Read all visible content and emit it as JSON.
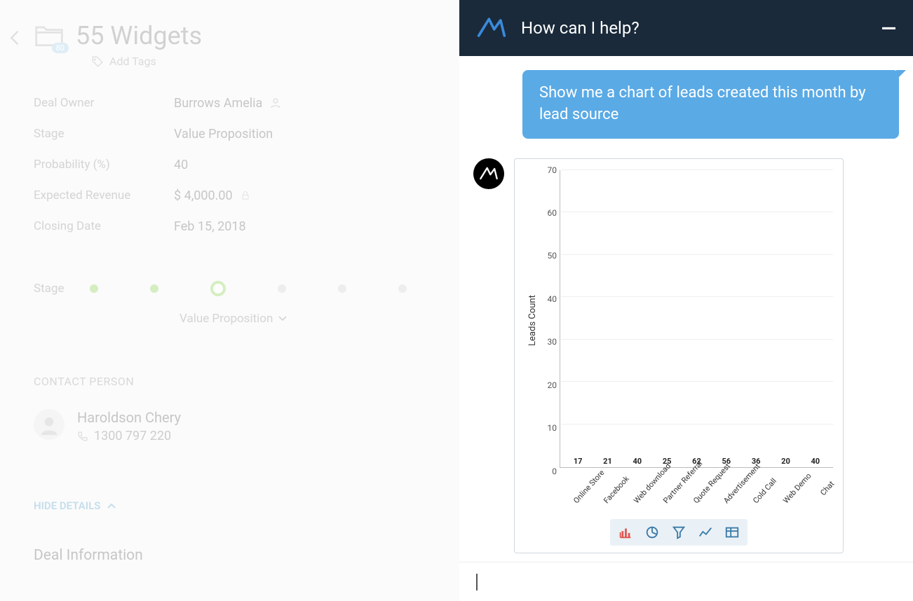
{
  "deal": {
    "title": "55 Widgets",
    "folder_badge": "80",
    "add_tags": "Add Tags",
    "fields": {
      "owner_label": "Deal Owner",
      "owner_value": "Burrows Amelia",
      "stage_label": "Stage",
      "stage_value": "Value Proposition",
      "probability_label": "Probability (%)",
      "probability_value": "40",
      "revenue_label": "Expected Revenue",
      "revenue_value": "$ 4,000.00",
      "closing_label": "Closing Date",
      "closing_value": "Feb 15, 2018"
    },
    "stage_progress": {
      "label": "Stage",
      "dropdown": "Value Proposition"
    },
    "contact": {
      "heading": "CONTACT PERSON",
      "name": "Haroldson Chery",
      "phone": "1300 797 220"
    },
    "hide_details": "HIDE DETAILS",
    "deal_info_heading": "Deal Information"
  },
  "chat": {
    "title": "How can I help?",
    "user_message": "Show me a chart of leads created this month by lead source"
  },
  "chart_data": {
    "type": "bar",
    "ylabel": "Leads Count",
    "ylim": [
      0,
      70
    ],
    "yticks": [
      0,
      10,
      20,
      30,
      40,
      50,
      60,
      70
    ],
    "categories": [
      "Online Store",
      "Facebook",
      "Web download",
      "Partner Referral",
      "Quote Request",
      "Advertisement",
      "Cold Call",
      "Web Demo",
      "Chat"
    ],
    "values": [
      17,
      21,
      40,
      25,
      62,
      56,
      36,
      20,
      40
    ],
    "colors": [
      "#e9524f",
      "#ec5f99",
      "#9a4fd6",
      "#2f7fd1",
      "#26c0e4",
      "#1ed0aa",
      "#6bbf3f",
      "#b8d43c",
      "#f07a3c"
    ]
  }
}
